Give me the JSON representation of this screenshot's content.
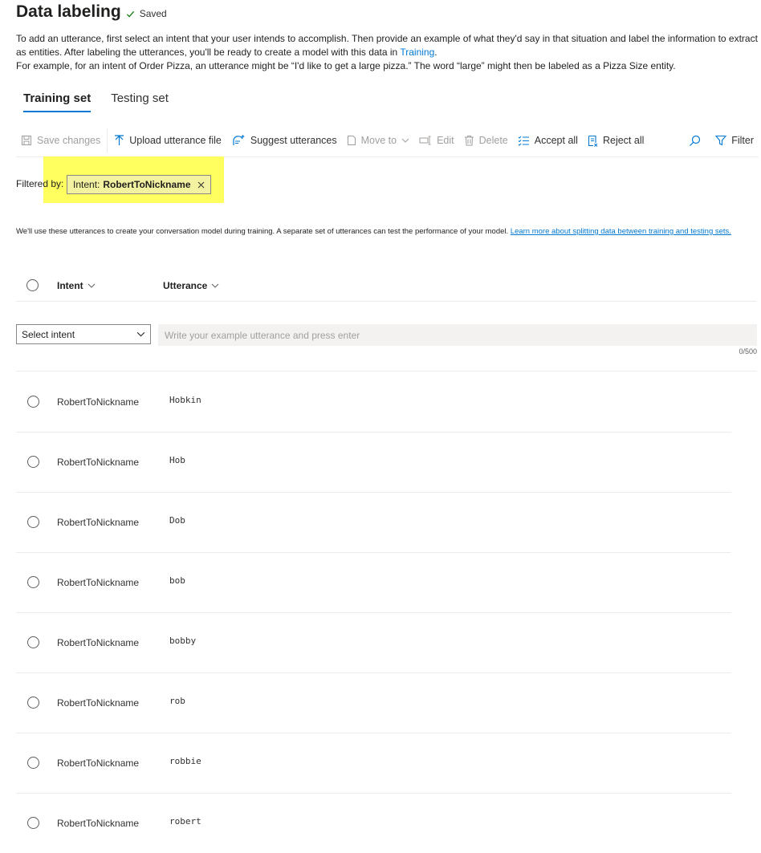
{
  "header": {
    "title": "Data labeling",
    "saved": "Saved"
  },
  "description": {
    "line1": "To add an utterance, first select an intent that your user intends to accomplish. Then provide an example of what they'd say in that situation and label the information to extract as entities. After labeling the utterances, you'll be ready to create a model with this data in ",
    "link": "Training",
    "line1_end": ".",
    "line2": "For example, for an intent of Order Pizza, an utterance might be “I'd like to get a large pizza.” The word “large” might then be labeled as a Pizza Size entity."
  },
  "tabs": [
    {
      "label": "Training set"
    },
    {
      "label": "Testing set"
    }
  ],
  "toolbar": {
    "save": "Save changes",
    "upload": "Upload utterance file",
    "suggest": "Suggest utterances",
    "move": "Move to",
    "edit": "Edit",
    "delete": "Delete",
    "accept": "Accept all",
    "reject": "Reject all",
    "filter": "Filter"
  },
  "filter": {
    "label": "Filtered by:",
    "chip_prefix": "Intent:",
    "chip_value": "RobertToNickname"
  },
  "info": {
    "text": "We'll use these utterances to create your conversation model during training. A separate set of utterances can test the performance of your model. ",
    "link": "Learn more about splitting data between training and testing sets."
  },
  "table": {
    "col_intent": "Intent",
    "col_utterance": "Utterance"
  },
  "new_entry": {
    "select_label": "Select intent",
    "placeholder": "Write your example utterance and press enter",
    "counter": "0/500"
  },
  "rows": [
    {
      "intent": "RobertToNickname",
      "utterance": "Hobkin"
    },
    {
      "intent": "RobertToNickname",
      "utterance": "Hob"
    },
    {
      "intent": "RobertToNickname",
      "utterance": "Dob"
    },
    {
      "intent": "RobertToNickname",
      "utterance": "bob"
    },
    {
      "intent": "RobertToNickname",
      "utterance": "bobby"
    },
    {
      "intent": "RobertToNickname",
      "utterance": "rob"
    },
    {
      "intent": "RobertToNickname",
      "utterance": "robbie"
    },
    {
      "intent": "RobertToNickname",
      "utterance": "robert"
    }
  ],
  "colors": {
    "accent": "#0078d4",
    "highlight": "#ffff44"
  }
}
